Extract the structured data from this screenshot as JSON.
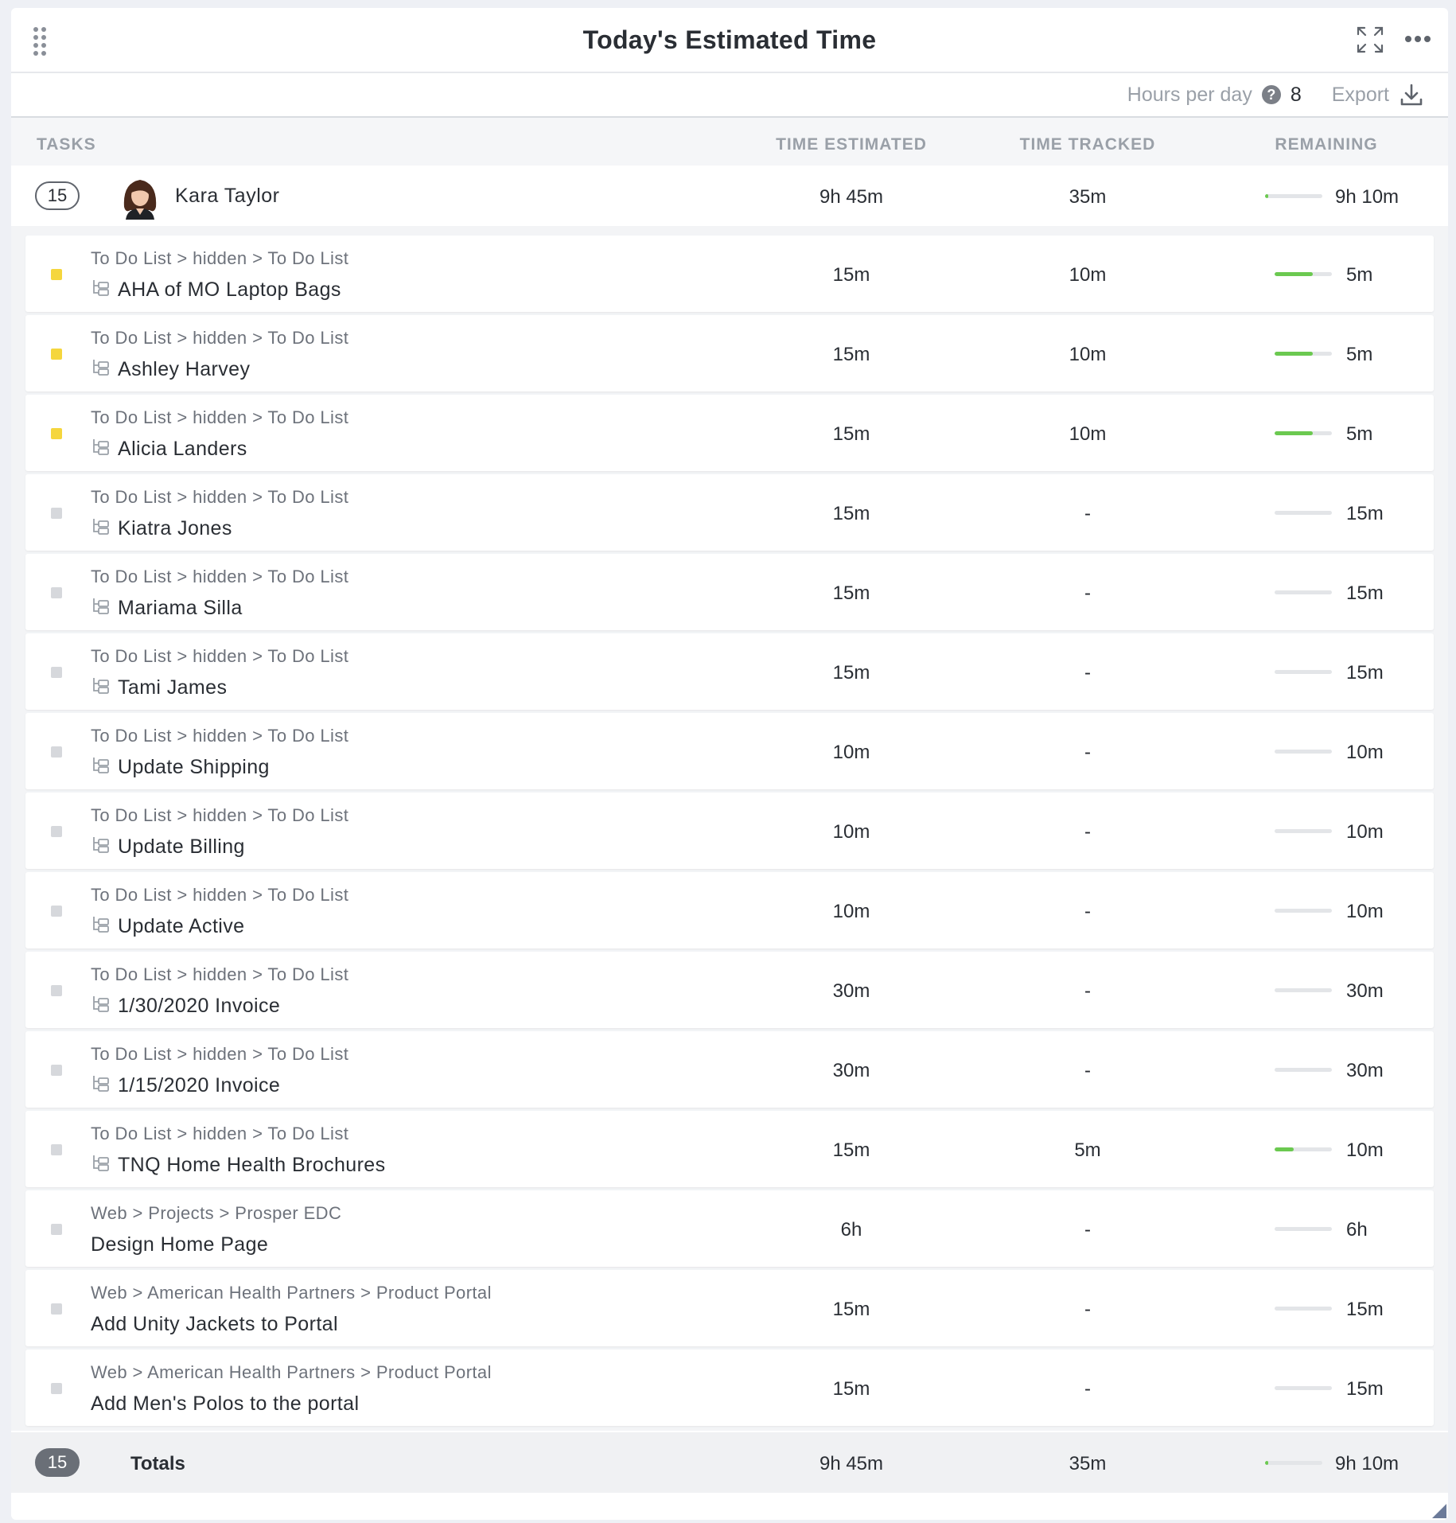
{
  "widget": {
    "title": "Today's Estimated Time",
    "expand_icon": "expand-icon",
    "more_icon": "more-horizontal-icon"
  },
  "toolbar": {
    "hours_label": "Hours per day",
    "help_glyph": "?",
    "hours_value": "8",
    "export_label": "Export"
  },
  "columns": {
    "tasks": "TASKS",
    "estimated": "TIME ESTIMATED",
    "tracked": "TIME TRACKED",
    "remaining": "REMAINING"
  },
  "colors": {
    "status_yellow": "#f5d63d",
    "status_gray": "#d6d8dc",
    "progress_green": "#6bc950",
    "progress_track": "#e3e5e8"
  },
  "user": {
    "count": "15",
    "name": "Kara Taylor",
    "estimated": "9h 45m",
    "tracked": "35m",
    "remaining": "9h 10m",
    "progress": 0.06
  },
  "tasks": [
    {
      "crumb": "To Do List > hidden > To Do List",
      "name": "AHA of MO Laptop Bags",
      "subtask": true,
      "status": "yellow",
      "estimated": "15m",
      "tracked": "10m",
      "remaining": "5m",
      "progress": 0.67
    },
    {
      "crumb": "To Do List > hidden > To Do List",
      "name": "Ashley Harvey",
      "subtask": true,
      "status": "yellow",
      "estimated": "15m",
      "tracked": "10m",
      "remaining": "5m",
      "progress": 0.67
    },
    {
      "crumb": "To Do List > hidden > To Do List",
      "name": "Alicia Landers",
      "subtask": true,
      "status": "yellow",
      "estimated": "15m",
      "tracked": "10m",
      "remaining": "5m",
      "progress": 0.67
    },
    {
      "crumb": "To Do List > hidden > To Do List",
      "name": "Kiatra Jones",
      "subtask": true,
      "status": "gray",
      "estimated": "15m",
      "tracked": "-",
      "remaining": "15m",
      "progress": 0
    },
    {
      "crumb": "To Do List > hidden > To Do List",
      "name": "Mariama Silla",
      "subtask": true,
      "status": "gray",
      "estimated": "15m",
      "tracked": "-",
      "remaining": "15m",
      "progress": 0
    },
    {
      "crumb": "To Do List > hidden > To Do List",
      "name": "Tami James",
      "subtask": true,
      "status": "gray",
      "estimated": "15m",
      "tracked": "-",
      "remaining": "15m",
      "progress": 0
    },
    {
      "crumb": "To Do List > hidden > To Do List",
      "name": "Update Shipping",
      "subtask": true,
      "status": "gray",
      "estimated": "10m",
      "tracked": "-",
      "remaining": "10m",
      "progress": 0
    },
    {
      "crumb": "To Do List > hidden > To Do List",
      "name": "Update Billing",
      "subtask": true,
      "status": "gray",
      "estimated": "10m",
      "tracked": "-",
      "remaining": "10m",
      "progress": 0
    },
    {
      "crumb": "To Do List > hidden > To Do List",
      "name": "Update Active",
      "subtask": true,
      "status": "gray",
      "estimated": "10m",
      "tracked": "-",
      "remaining": "10m",
      "progress": 0
    },
    {
      "crumb": "To Do List > hidden > To Do List",
      "name": "1/30/2020 Invoice",
      "subtask": true,
      "status": "gray",
      "estimated": "30m",
      "tracked": "-",
      "remaining": "30m",
      "progress": 0
    },
    {
      "crumb": "To Do List > hidden > To Do List",
      "name": "1/15/2020 Invoice",
      "subtask": true,
      "status": "gray",
      "estimated": "30m",
      "tracked": "-",
      "remaining": "30m",
      "progress": 0
    },
    {
      "crumb": "To Do List > hidden > To Do List",
      "name": "TNQ Home Health Brochures",
      "subtask": true,
      "status": "gray",
      "estimated": "15m",
      "tracked": "5m",
      "remaining": "10m",
      "progress": 0.33
    },
    {
      "crumb": "Web > Projects > Prosper EDC",
      "name": "Design Home Page",
      "subtask": false,
      "status": "gray",
      "estimated": "6h",
      "tracked": "-",
      "remaining": "6h",
      "progress": 0
    },
    {
      "crumb": "Web > American Health Partners > Product Portal",
      "name": "Add Unity Jackets to Portal",
      "subtask": false,
      "status": "gray",
      "estimated": "15m",
      "tracked": "-",
      "remaining": "15m",
      "progress": 0
    },
    {
      "crumb": "Web > American Health Partners > Product Portal",
      "name": "Add Men's Polos to the portal",
      "subtask": false,
      "status": "gray",
      "estimated": "15m",
      "tracked": "-",
      "remaining": "15m",
      "progress": 0
    }
  ],
  "totals": {
    "count": "15",
    "label": "Totals",
    "estimated": "9h 45m",
    "tracked": "35m",
    "remaining": "9h 10m",
    "progress": 0.06
  }
}
